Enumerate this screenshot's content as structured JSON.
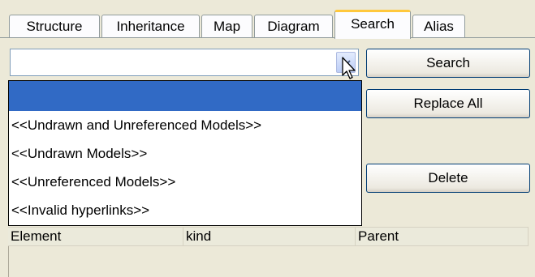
{
  "tabs": [
    {
      "label": "Structure"
    },
    {
      "label": "Inheritance"
    },
    {
      "label": "Map"
    },
    {
      "label": "Diagram"
    },
    {
      "label": "Search",
      "active": true
    },
    {
      "label": "Alias"
    }
  ],
  "search": {
    "combo_value": "",
    "buttons": {
      "search": "Search",
      "replace_all": "Replace All",
      "delete": "Delete"
    }
  },
  "dropdown": {
    "items": [
      {
        "label": "",
        "selected": true
      },
      {
        "label": "<<Undrawn and Unreferenced Models>>"
      },
      {
        "label": "<<Undrawn Models>>"
      },
      {
        "label": "<<Unreferenced Models>>"
      },
      {
        "label": "<<Invalid hyperlinks>>"
      }
    ]
  },
  "results": {
    "columns": [
      "Element",
      "kind",
      "Parent"
    ]
  },
  "colors": {
    "selection": "#316ac5",
    "active_tab_accent": "#ffc83c",
    "button_border": "#003c74",
    "background": "#ece9d8"
  },
  "icons": [
    "chevron-down-icon",
    "mouse-pointer-icon"
  ]
}
